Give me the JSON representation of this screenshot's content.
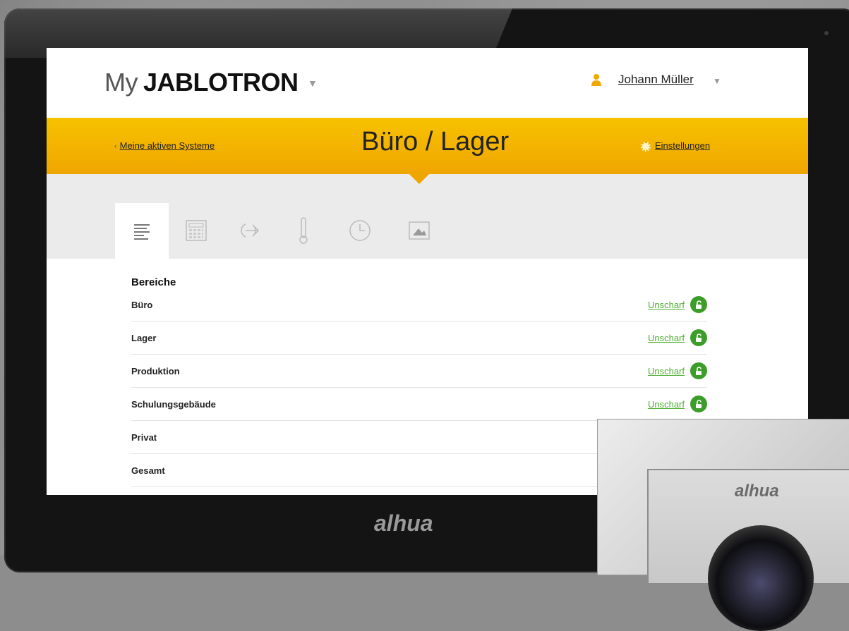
{
  "app": {
    "logo_prefix": "My",
    "logo_brand": "JABLOTRON"
  },
  "user": {
    "name": "Johann Müller"
  },
  "nav": {
    "back_label": "Meine aktiven Systeme",
    "page_title": "Büro / Lager",
    "settings_label": "Einstellungen"
  },
  "tabs": [
    {
      "icon": "list-icon",
      "active": true
    },
    {
      "icon": "keypad-icon",
      "active": false
    },
    {
      "icon": "output-arrow-icon",
      "active": false
    },
    {
      "icon": "thermometer-icon",
      "active": false
    },
    {
      "icon": "clock-icon",
      "active": false
    },
    {
      "icon": "image-icon",
      "active": false
    }
  ],
  "sections": {
    "title": "Bereiche",
    "rows": [
      {
        "name": "Büro",
        "state": "Unscharf"
      },
      {
        "name": "Lager",
        "state": "Unscharf"
      },
      {
        "name": "Produktion",
        "state": "Unscharf"
      },
      {
        "name": "Schulungsgebäude",
        "state": "Unscharf"
      },
      {
        "name": "Privat",
        "state": ""
      },
      {
        "name": "Gesamt",
        "state": ""
      }
    ]
  },
  "hardware": {
    "monitor_brand": "alhua",
    "intercom_brand": "alhua"
  },
  "colors": {
    "accent_yellow": "#f7c200",
    "status_green": "#3d9d2a"
  }
}
